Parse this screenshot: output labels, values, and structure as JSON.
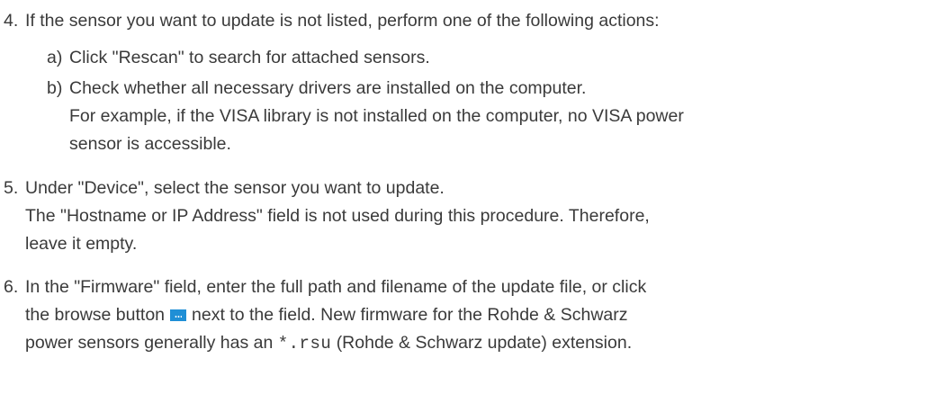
{
  "step4": {
    "number": "4.",
    "text": "If the sensor you want to update is not listed, perform one of the following actions:",
    "sub_a": {
      "label": "a)",
      "text": "Click \"Rescan\" to search for attached sensors."
    },
    "sub_b": {
      "label": "b)",
      "line1": "Check whether all necessary drivers are installed on the computer.",
      "line2": "For example, if the VISA library is not installed on the computer, no VISA power",
      "line3": "sensor is accessible."
    }
  },
  "step5": {
    "number": "5.",
    "line1": "Under \"Device\", select the sensor you want to update.",
    "line2": "The \"Hostname or IP Address\" field is not used during this procedure. Therefore,",
    "line3": "leave it empty."
  },
  "step6": {
    "number": "6.",
    "line1": "In the \"Firmware\" field, enter the full path and filename of the update file, or click",
    "line2_before": "the browse button",
    "line2_after": "next to the field. New firmware for the Rohde & Schwarz",
    "line3_before": "power sensors generally has an",
    "line3_code": "*.rsu",
    "line3_after": "(Rohde & Schwarz update) extension."
  },
  "icons": {
    "browse_button": "browse-button-icon"
  },
  "colors": {
    "text": "#3a3a3a",
    "browse_button": "#1f8fd6"
  }
}
